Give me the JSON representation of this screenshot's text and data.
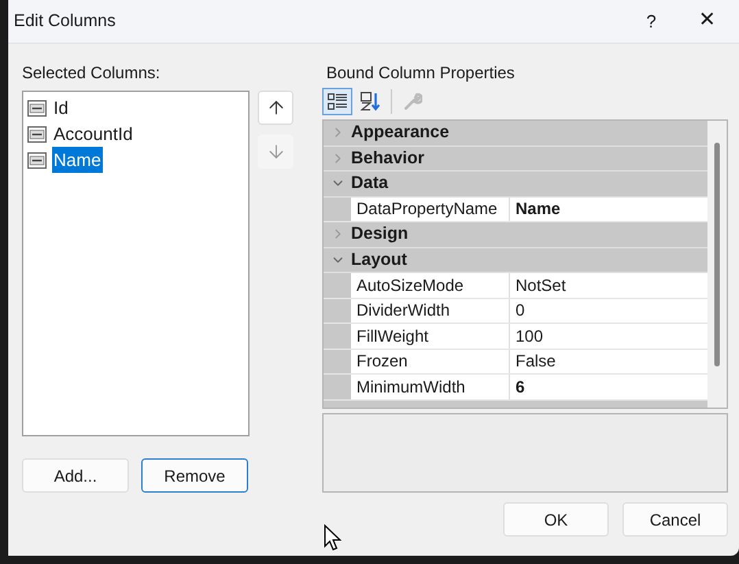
{
  "window": {
    "title": "Edit Columns",
    "help": "?",
    "close": "✕"
  },
  "selected_columns": {
    "label": "Selected Columns:",
    "items": [
      {
        "name": "Id",
        "selected": false
      },
      {
        "name": "AccountId",
        "selected": false
      },
      {
        "name": "Name",
        "selected": true
      }
    ],
    "move_up": {
      "disabled": false
    },
    "move_down": {
      "disabled": true
    },
    "buttons": [
      {
        "label": "Add...",
        "focused": false
      },
      {
        "label": "Remove",
        "focused": true
      }
    ]
  },
  "properties": {
    "label": "Bound Column Properties",
    "toolbar": [
      {
        "kind": "categorized",
        "selected": true,
        "disabled": false
      },
      {
        "kind": "alphabetical",
        "selected": false,
        "disabled": false
      },
      {
        "kind": "pages",
        "selected": false,
        "disabled": true
      }
    ],
    "categories": [
      {
        "name": "Appearance",
        "expanded": false
      },
      {
        "name": "Behavior",
        "expanded": false
      },
      {
        "name": "Data",
        "expanded": true,
        "children": [
          {
            "name": "DataPropertyName",
            "value": "Name",
            "modified": true
          }
        ]
      },
      {
        "name": "Design",
        "expanded": false
      },
      {
        "name": "Layout",
        "expanded": true,
        "children": [
          {
            "name": "AutoSizeMode",
            "value": "NotSet",
            "modified": false
          },
          {
            "name": "DividerWidth",
            "value": "0",
            "modified": false
          },
          {
            "name": "FillWeight",
            "value": "100",
            "modified": false
          },
          {
            "name": "Frozen",
            "value": "False",
            "modified": false
          },
          {
            "name": "MinimumWidth",
            "value": "6",
            "modified": true
          }
        ]
      }
    ]
  },
  "footer_buttons": [
    "OK",
    "Cancel"
  ]
}
